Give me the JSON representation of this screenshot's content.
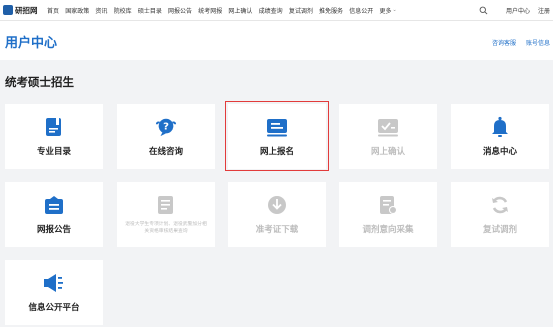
{
  "nav": {
    "logo_text": "研招网",
    "items": [
      "首页",
      "国家政策",
      "资讯",
      "院校库",
      "硕士目录",
      "网报公告",
      "统考网报",
      "网上确认",
      "成绩查询",
      "复试调剂",
      "推免服务",
      "信息公开"
    ],
    "more": "更多",
    "right_items": [
      "用户中心",
      "注册"
    ]
  },
  "header": {
    "title": "用户中心",
    "links": [
      "咨询客服",
      "账号信息"
    ]
  },
  "section_title": "统考硕士招生",
  "cards": [
    {
      "label": "专业目录",
      "icon": "book-icon",
      "disabled": false
    },
    {
      "label": "在线咨询",
      "icon": "chat-question-icon",
      "disabled": false
    },
    {
      "label": "网上报名",
      "icon": "registration-icon",
      "disabled": false
    },
    {
      "label": "网上确认",
      "icon": "confirm-icon",
      "disabled": true
    },
    {
      "label": "消息中心",
      "icon": "bell-icon",
      "disabled": false
    },
    {
      "label": "网报公告",
      "icon": "announcement-icon",
      "disabled": false
    },
    {
      "label": "",
      "icon": "document-icon",
      "disabled": true,
      "note": "退役大学生专项计划、退役武警加分相关资格审核结果查询"
    },
    {
      "label": "准考证下载",
      "icon": "download-icon",
      "disabled": true
    },
    {
      "label": "调剂意向采集",
      "icon": "intent-form-icon",
      "disabled": true
    },
    {
      "label": "复试调剂",
      "icon": "refresh-icon",
      "disabled": true
    },
    {
      "label": "信息公开平台",
      "icon": "megaphone-icon",
      "disabled": false
    }
  ],
  "colors": {
    "accent": "#1f6fc8",
    "disabled_icon": "#c8c8c8",
    "highlight": "#e23b3b"
  }
}
